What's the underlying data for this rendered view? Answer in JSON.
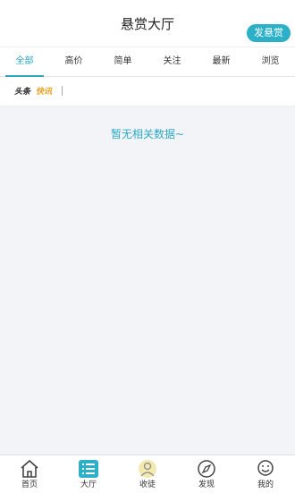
{
  "header": {
    "title": "悬赏大厅",
    "post_button": "发悬赏"
  },
  "tabs": [
    {
      "label": "全部"
    },
    {
      "label": "高价"
    },
    {
      "label": "简单"
    },
    {
      "label": "关注"
    },
    {
      "label": "最新"
    },
    {
      "label": "浏览"
    }
  ],
  "newsbar": {
    "label_a": "头条",
    "label_b": "快讯"
  },
  "empty_text": "暂无相关数据~",
  "bottom_nav": [
    {
      "label": "首页",
      "icon": "home-icon"
    },
    {
      "label": "大厅",
      "icon": "list-icon"
    },
    {
      "label": "收徒",
      "icon": "apprentice-icon"
    },
    {
      "label": "发现",
      "icon": "compass-icon"
    },
    {
      "label": "我的",
      "icon": "user-icon"
    }
  ],
  "colors": {
    "accent": "#2bb0c8",
    "news_highlight": "#e8a020",
    "background": "#f2f4f8"
  }
}
